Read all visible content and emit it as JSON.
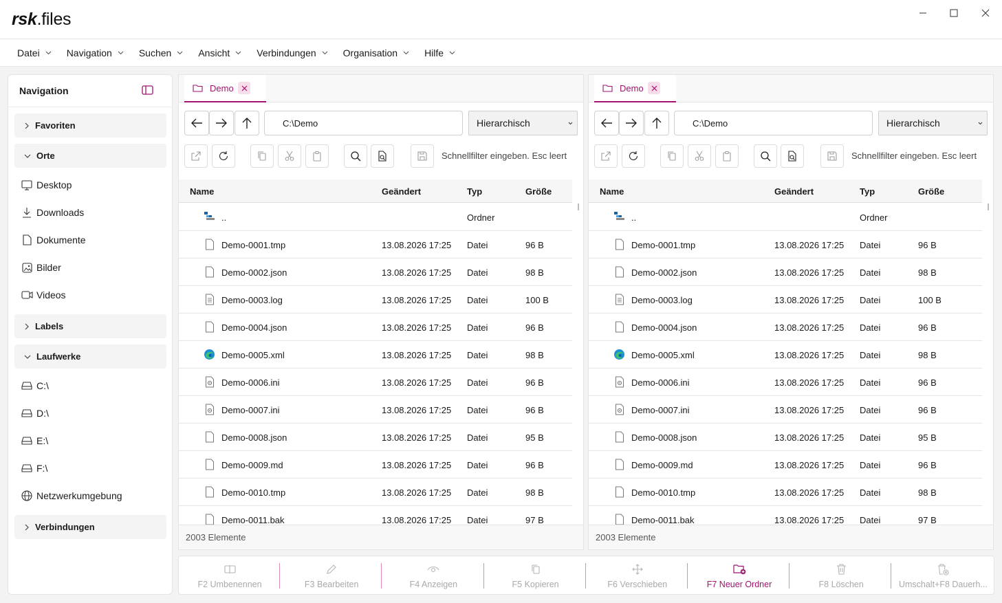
{
  "app": {
    "logo_bold": "rsk",
    "logo_rest": ".files"
  },
  "menu": [
    "Datei",
    "Navigation",
    "Suchen",
    "Ansicht",
    "Verbindungen",
    "Organisation",
    "Hilfe"
  ],
  "sidebar": {
    "title": "Navigation",
    "groups": {
      "favoriten": "Favoriten",
      "orte": "Orte",
      "labels": "Labels",
      "laufwerke": "Laufwerke",
      "verbindungen": "Verbindungen"
    },
    "orte": [
      "Desktop",
      "Downloads",
      "Dokumente",
      "Bilder",
      "Videos"
    ],
    "laufwerke": [
      "C:\\",
      "D:\\",
      "E:\\",
      "F:\\",
      "Netzwerkumgebung"
    ]
  },
  "pane": {
    "tab_label": "Demo",
    "path": "C:\\Demo",
    "view_mode": "Hierarchisch",
    "filter_placeholder": "Schnellfilter eingeben. Esc leert",
    "columns": {
      "name": "Name",
      "modified": "Geändert",
      "type": "Typ",
      "size": "Größe"
    },
    "rows": [
      {
        "icon": "parent-folder-icon",
        "name": "..",
        "modified": "",
        "type": "Ordner",
        "size": ""
      },
      {
        "icon": "file-icon",
        "name": "Demo-0001.tmp",
        "modified": "13.08.2026 17:25",
        "type": "Datei",
        "size": "96 B"
      },
      {
        "icon": "file-icon",
        "name": "Demo-0002.json",
        "modified": "13.08.2026 17:25",
        "type": "Datei",
        "size": "98 B"
      },
      {
        "icon": "text-file-icon",
        "name": "Demo-0003.log",
        "modified": "13.08.2026 17:25",
        "type": "Datei",
        "size": "100 B"
      },
      {
        "icon": "file-icon",
        "name": "Demo-0004.json",
        "modified": "13.08.2026 17:25",
        "type": "Datei",
        "size": "96 B"
      },
      {
        "icon": "edge-icon",
        "name": "Demo-0005.xml",
        "modified": "13.08.2026 17:25",
        "type": "Datei",
        "size": "98 B"
      },
      {
        "icon": "settings-file-icon",
        "name": "Demo-0006.ini",
        "modified": "13.08.2026 17:25",
        "type": "Datei",
        "size": "96 B"
      },
      {
        "icon": "settings-file-icon",
        "name": "Demo-0007.ini",
        "modified": "13.08.2026 17:25",
        "type": "Datei",
        "size": "96 B"
      },
      {
        "icon": "file-icon",
        "name": "Demo-0008.json",
        "modified": "13.08.2026 17:25",
        "type": "Datei",
        "size": "95 B"
      },
      {
        "icon": "file-icon",
        "name": "Demo-0009.md",
        "modified": "13.08.2026 17:25",
        "type": "Datei",
        "size": "96 B"
      },
      {
        "icon": "file-icon",
        "name": "Demo-0010.tmp",
        "modified": "13.08.2026 17:25",
        "type": "Datei",
        "size": "98 B"
      },
      {
        "icon": "file-icon",
        "name": "Demo-0011.bak",
        "modified": "13.08.2026 17:25",
        "type": "Datei",
        "size": "97 B"
      }
    ],
    "status": "2003 Elemente"
  },
  "fkeys": [
    "F2 Umbenennen",
    "F3 Bearbeiten",
    "F4 Anzeigen",
    "F5 Kopieren",
    "F6 Verschieben",
    "F7 Neuer Ordner",
    "F8 Löschen",
    "Umschalt+F8 Dauerh..."
  ],
  "colors": {
    "accent": "#a0126e",
    "disabled": "#a9a9a9"
  }
}
